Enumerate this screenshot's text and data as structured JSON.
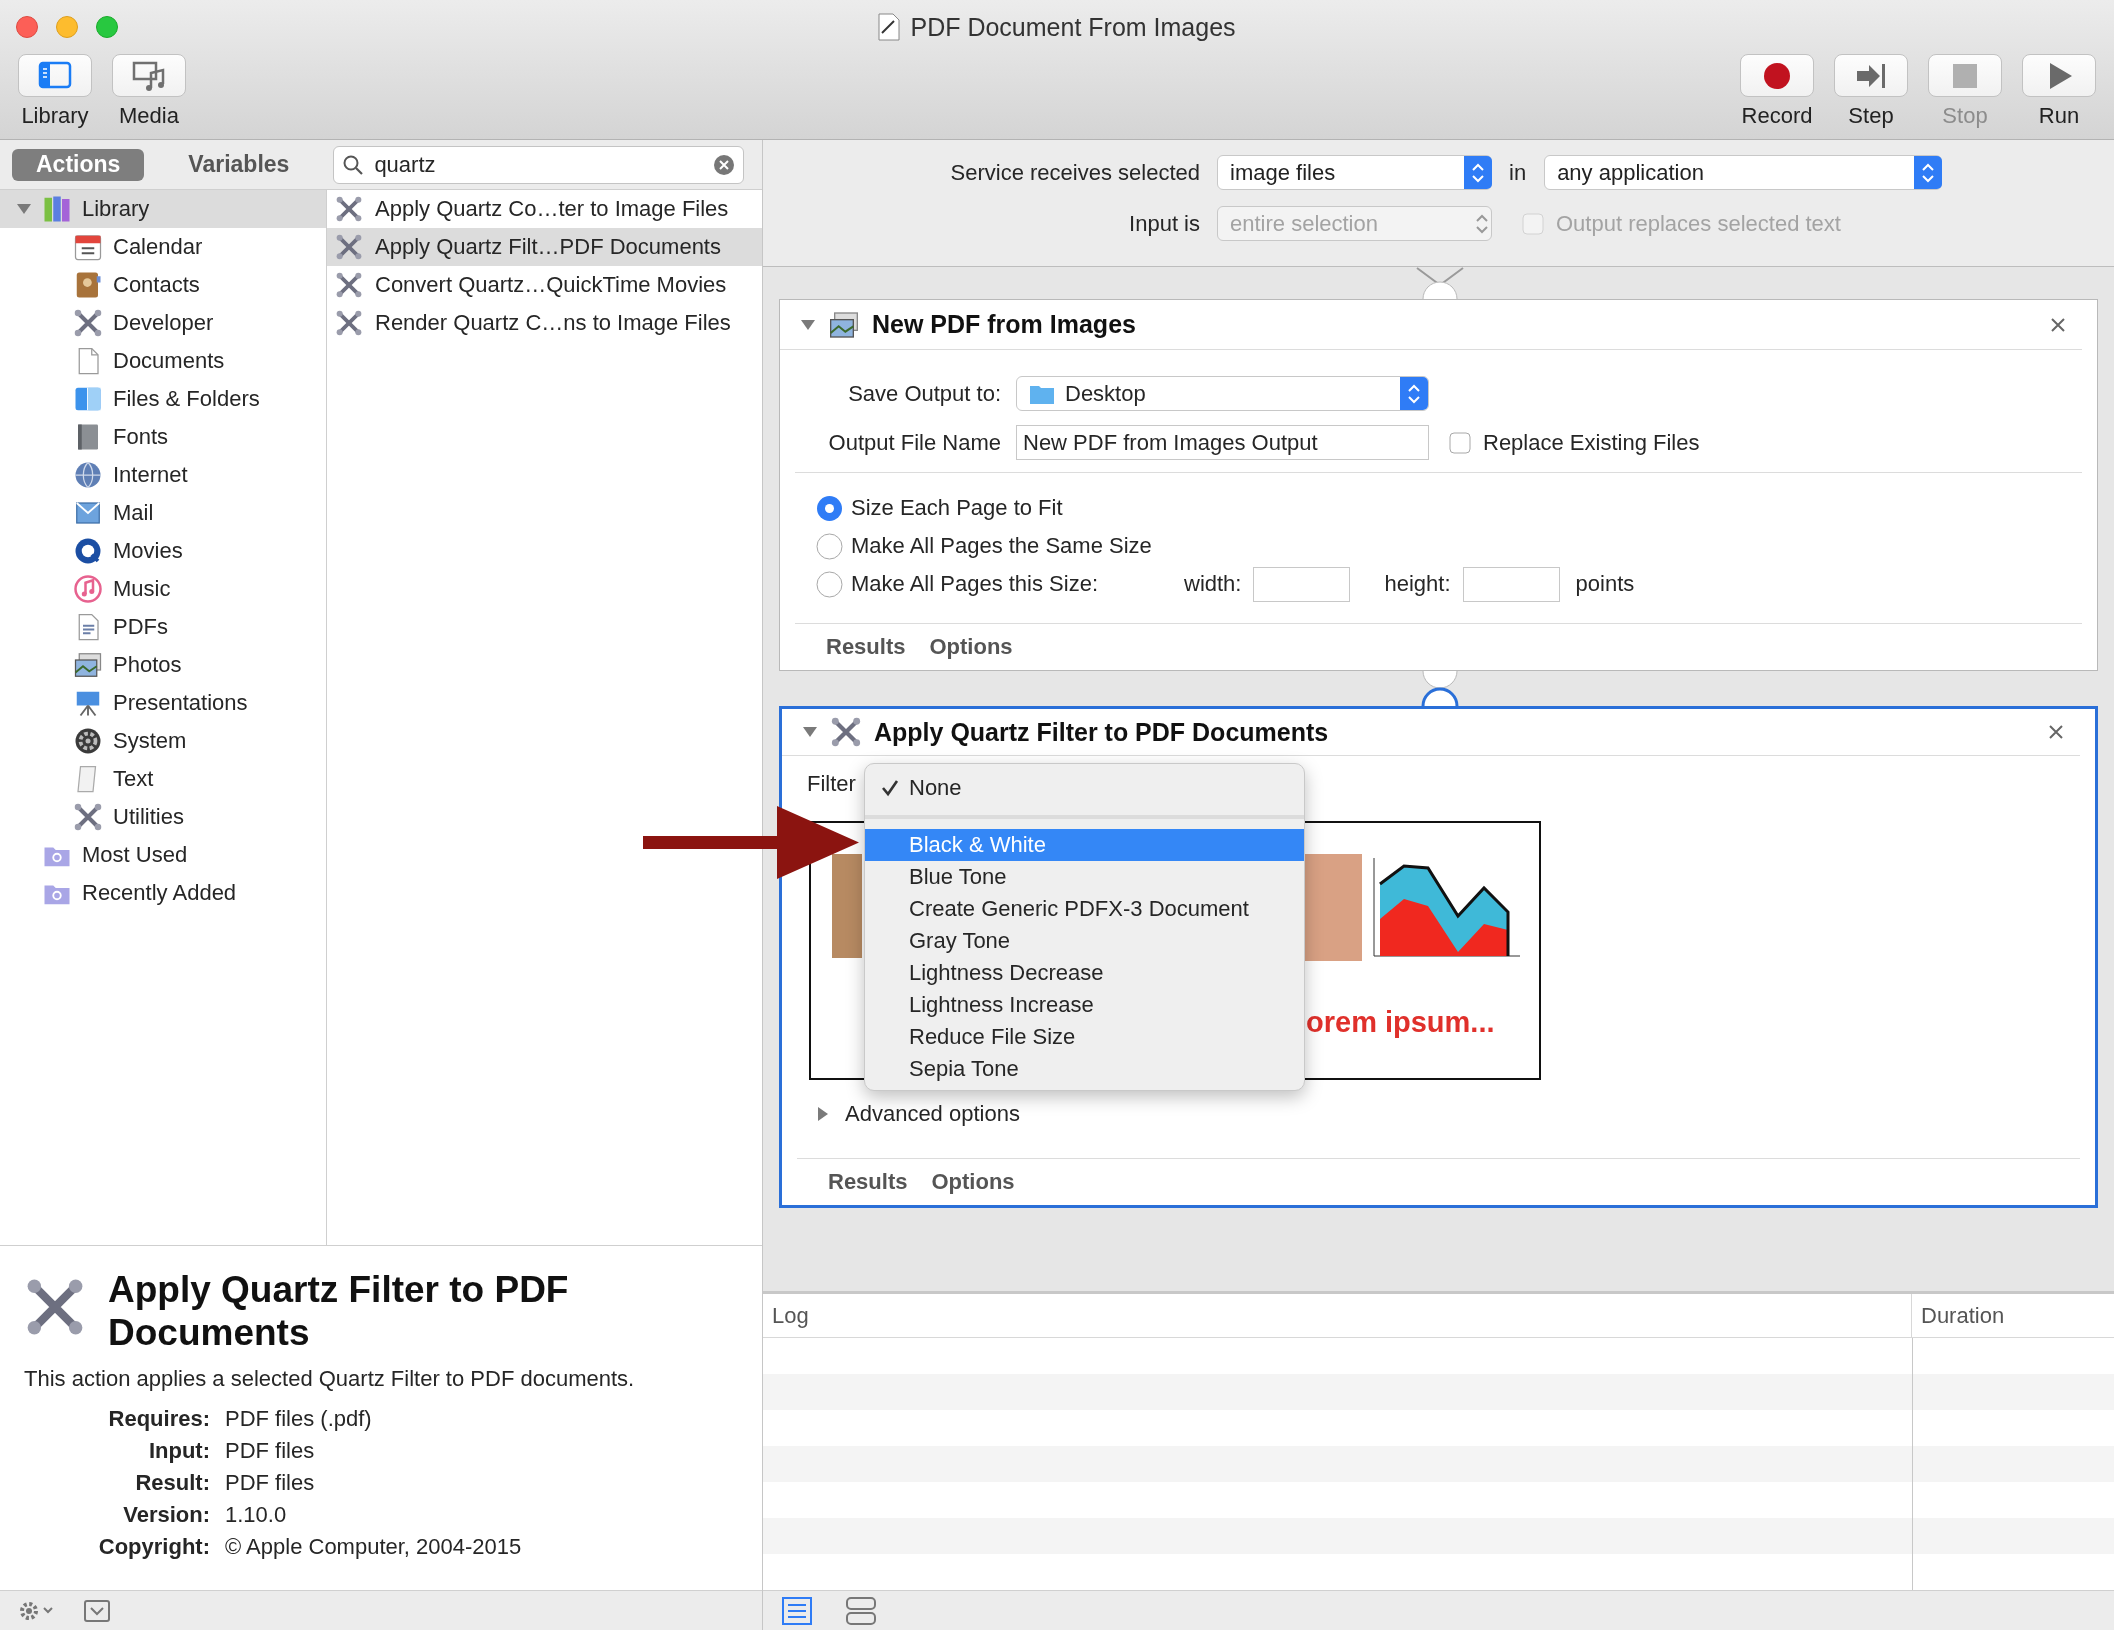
{
  "window": {
    "title": "PDF Document From Images"
  },
  "toolbar": {
    "left": [
      {
        "label": "Library",
        "kind": "library",
        "selected": true
      },
      {
        "label": "Media",
        "kind": "media",
        "selected": false
      }
    ],
    "right": [
      {
        "label": "Record",
        "kind": "record",
        "disabled": false
      },
      {
        "label": "Step",
        "kind": "step",
        "disabled": false
      },
      {
        "label": "Stop",
        "kind": "stop",
        "disabled": true
      },
      {
        "label": "Run",
        "kind": "run",
        "disabled": false
      }
    ]
  },
  "library_tabs": [
    {
      "label": "Actions",
      "selected": true
    },
    {
      "label": "Variables",
      "selected": false
    }
  ],
  "search": {
    "value": "quartz"
  },
  "library_tree": [
    {
      "label": "Library",
      "kind": "library",
      "expanded": true,
      "selected": true,
      "children": [
        {
          "label": "Calendar",
          "kind": "calendar",
          "selected": false
        },
        {
          "label": "Contacts",
          "kind": "contacts",
          "selected": false
        },
        {
          "label": "Developer",
          "kind": "developer",
          "selected": false
        },
        {
          "label": "Documents",
          "kind": "documents",
          "selected": false
        },
        {
          "label": "Files & Folders",
          "kind": "files",
          "selected": false
        },
        {
          "label": "Fonts",
          "kind": "fonts",
          "selected": false
        },
        {
          "label": "Internet",
          "kind": "internet",
          "selected": false
        },
        {
          "label": "Mail",
          "kind": "mail",
          "selected": false
        },
        {
          "label": "Movies",
          "kind": "movies",
          "selected": false
        },
        {
          "label": "Music",
          "kind": "music",
          "selected": false
        },
        {
          "label": "PDFs",
          "kind": "pdfs",
          "selected": false
        },
        {
          "label": "Photos",
          "kind": "photos",
          "selected": false
        },
        {
          "label": "Presentations",
          "kind": "presentations",
          "selected": false
        },
        {
          "label": "System",
          "kind": "system",
          "selected": false
        },
        {
          "label": "Text",
          "kind": "text",
          "selected": false
        },
        {
          "label": "Utilities",
          "kind": "utilities",
          "selected": false
        }
      ]
    },
    {
      "label": "Most Used",
      "kind": "smart-folder",
      "selected": false
    },
    {
      "label": "Recently Added",
      "kind": "smart-folder",
      "selected": false
    }
  ],
  "action_results": [
    {
      "label": "Apply Quartz Co…ter to Image Files",
      "selected": false
    },
    {
      "label": "Apply Quartz Filt…PDF Documents",
      "selected": true
    },
    {
      "label": "Convert Quartz…QuickTime Movies",
      "selected": false
    },
    {
      "label": "Render Quartz C…ns to Image Files",
      "selected": false
    }
  ],
  "service": {
    "label": "Service receives selected",
    "type": "image files",
    "in_label": "in",
    "application": "any application",
    "input_label": "Input is",
    "input": "entire selection",
    "input_disabled": true,
    "output_replaces": {
      "label": "Output replaces selected text",
      "checked": false,
      "disabled": true
    }
  },
  "new_pdf_action": {
    "title": "New PDF from Images",
    "expanded": true,
    "selected": false,
    "save_label": "Save Output to:",
    "save_location": "Desktop",
    "file_name_label": "Output File Name",
    "file_name": "New PDF from Images Output",
    "replace": {
      "label": "Replace Existing Files",
      "checked": false
    },
    "size_options": [
      {
        "label": "Size Each Page to Fit",
        "selected": true
      },
      {
        "label": "Make All Pages the Same Size",
        "selected": false
      },
      {
        "label": "Make All Pages this Size:",
        "selected": false
      }
    ],
    "width_label": "width:",
    "height_label": "height:",
    "units": "points",
    "footer": [
      "Results",
      "Options"
    ]
  },
  "filter_action": {
    "title": "Apply Quartz Filter to PDF Documents",
    "expanded": true,
    "selected": true,
    "filter_label": "Filter",
    "menu": [
      {
        "kind": "option",
        "label": "None",
        "checked": true,
        "selected": false
      },
      {
        "kind": "separator"
      },
      {
        "kind": "option",
        "label": "Black & White",
        "checked": false,
        "selected": true
      },
      {
        "kind": "option",
        "label": "Blue Tone",
        "checked": false,
        "selected": false
      },
      {
        "kind": "option",
        "label": "Create Generic PDFX-3 Document",
        "checked": false,
        "selected": false
      },
      {
        "kind": "option",
        "label": "Gray Tone",
        "checked": false,
        "selected": false
      },
      {
        "kind": "option",
        "label": "Lightness Decrease",
        "checked": false,
        "selected": false
      },
      {
        "kind": "option",
        "label": "Lightness Increase",
        "checked": false,
        "selected": false
      },
      {
        "kind": "option",
        "label": "Reduce File Size",
        "checked": false,
        "selected": false
      },
      {
        "kind": "option",
        "label": "Sepia Tone",
        "checked": false,
        "selected": false
      }
    ],
    "preview_text": "orem ipsum...",
    "advanced": {
      "label": "Advanced options",
      "expanded": false
    },
    "footer": [
      "Results",
      "Options"
    ]
  },
  "description": {
    "title": "Apply Quartz Filter to PDF Documents",
    "text": "This action applies a selected Quartz Filter to PDF documents.",
    "details": [
      {
        "label": "Requires:",
        "value": "PDF files (.pdf)"
      },
      {
        "label": "Input:",
        "value": "PDF files"
      },
      {
        "label": "Result:",
        "value": "PDF files"
      },
      {
        "label": "Version:",
        "value": "1.10.0"
      },
      {
        "label": "Copyright:",
        "value": "© Apple Computer, 2004-2015"
      }
    ]
  },
  "log": {
    "columns": [
      "Log",
      "Duration"
    ]
  }
}
